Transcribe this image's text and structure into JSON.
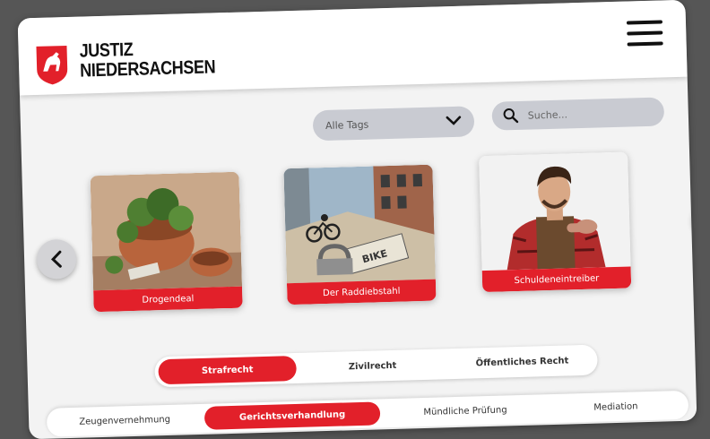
{
  "header": {
    "brand_line1": "JUSTIZ",
    "brand_line2": "NIEDERSACHSEN",
    "menu_icon": "hamburger-menu-icon"
  },
  "filters": {
    "tags_value": "Alle Tags",
    "search_placeholder": "Suche..."
  },
  "cards": [
    {
      "label": "Drogendeal",
      "image": "potted-plants-illustration"
    },
    {
      "label": "Der Raddiebstahl",
      "image": "bike-theft-street-illustration"
    },
    {
      "label": "Schuldeneintreiber",
      "image": "tattooed-man-illustration"
    }
  ],
  "law_tabs": [
    {
      "label": "Strafrecht",
      "active": true
    },
    {
      "label": "Zivilrecht",
      "active": false
    },
    {
      "label": "Öffentliches Recht",
      "active": false
    }
  ],
  "scenario_tabs": [
    {
      "label": "Zeugenvernehmung",
      "active": false
    },
    {
      "label": "Gerichtsverhandlung",
      "active": true
    },
    {
      "label": "Mündliche Prüfung",
      "active": false
    },
    {
      "label": "Mediation",
      "active": false
    }
  ],
  "colors": {
    "accent": "#e2202a",
    "background": "#565656",
    "panel": "#f3f3f3"
  }
}
